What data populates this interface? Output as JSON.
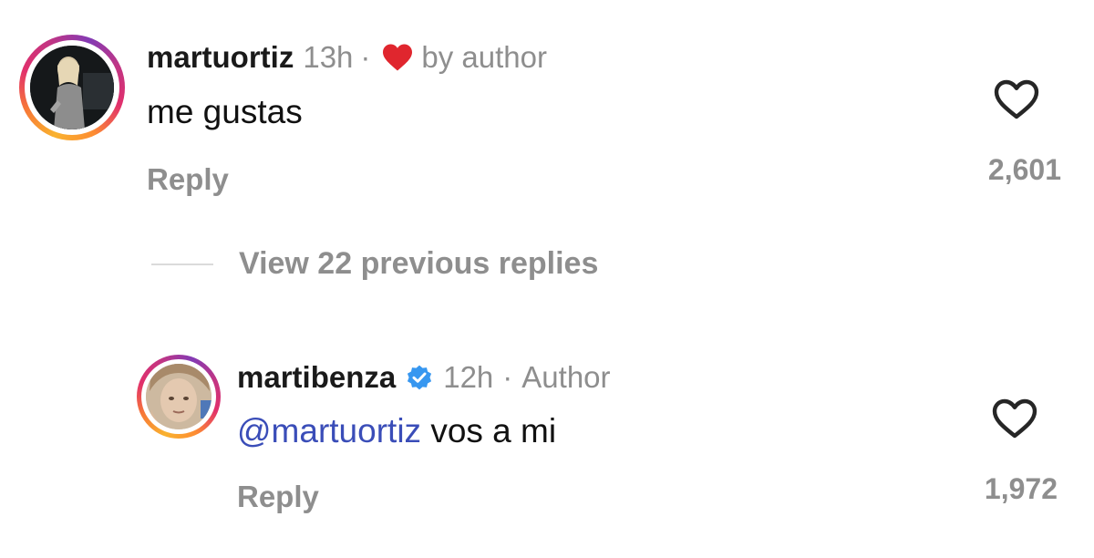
{
  "comments": [
    {
      "username": "martuortiz",
      "time": "13h",
      "separator": "·",
      "liked_by": "by author",
      "text": "me gustas",
      "reply_label": "Reply",
      "likes": "2,601"
    },
    {
      "username": "martibenza",
      "time": "12h",
      "separator": "·",
      "role": "Author",
      "mention": "@martuortiz",
      "text": " vos a mi",
      "reply_label": "Reply",
      "likes": "1,972",
      "verified": true
    }
  ],
  "thread": {
    "view_replies_label": "View 22 previous replies"
  },
  "colors": {
    "mention": "#3a4db8",
    "liked_heart": "#e0262e",
    "verified_badge": "#3797f0",
    "muted_text": "#8e8e8e"
  },
  "icons": {
    "like": "heart-outline-icon",
    "author_like": "heart-filled-icon",
    "verified": "verified-badge-icon"
  }
}
